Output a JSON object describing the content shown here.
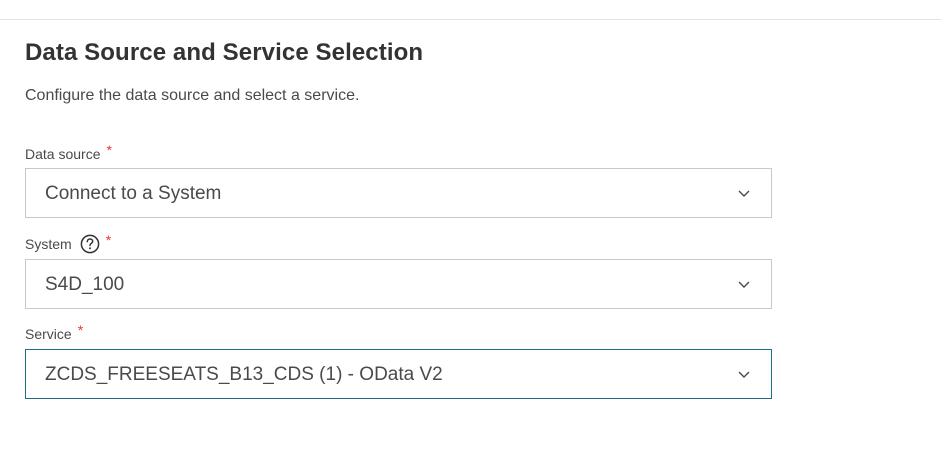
{
  "page": {
    "title": "Data Source and Service Selection",
    "subtitle": "Configure the data source and select a service."
  },
  "fields": {
    "data_source": {
      "label": "Data source",
      "required_mark": "*",
      "value": "Connect to a System",
      "icon": "chevron-down-icon"
    },
    "system": {
      "label": "System",
      "required_mark": "*",
      "help_icon": "question-circle-icon",
      "value": "S4D_100",
      "icon": "chevron-down-icon"
    },
    "service": {
      "label": "Service",
      "required_mark": "*",
      "value": "ZCDS_FREESEATS_B13_CDS (1) - OData V2",
      "icon": "chevron-down-icon",
      "focused": true
    }
  },
  "colors": {
    "required": "#e9372c",
    "focus_border": "#1d6f83",
    "border": "#c8c8c8",
    "text": "#4a4a4a"
  }
}
